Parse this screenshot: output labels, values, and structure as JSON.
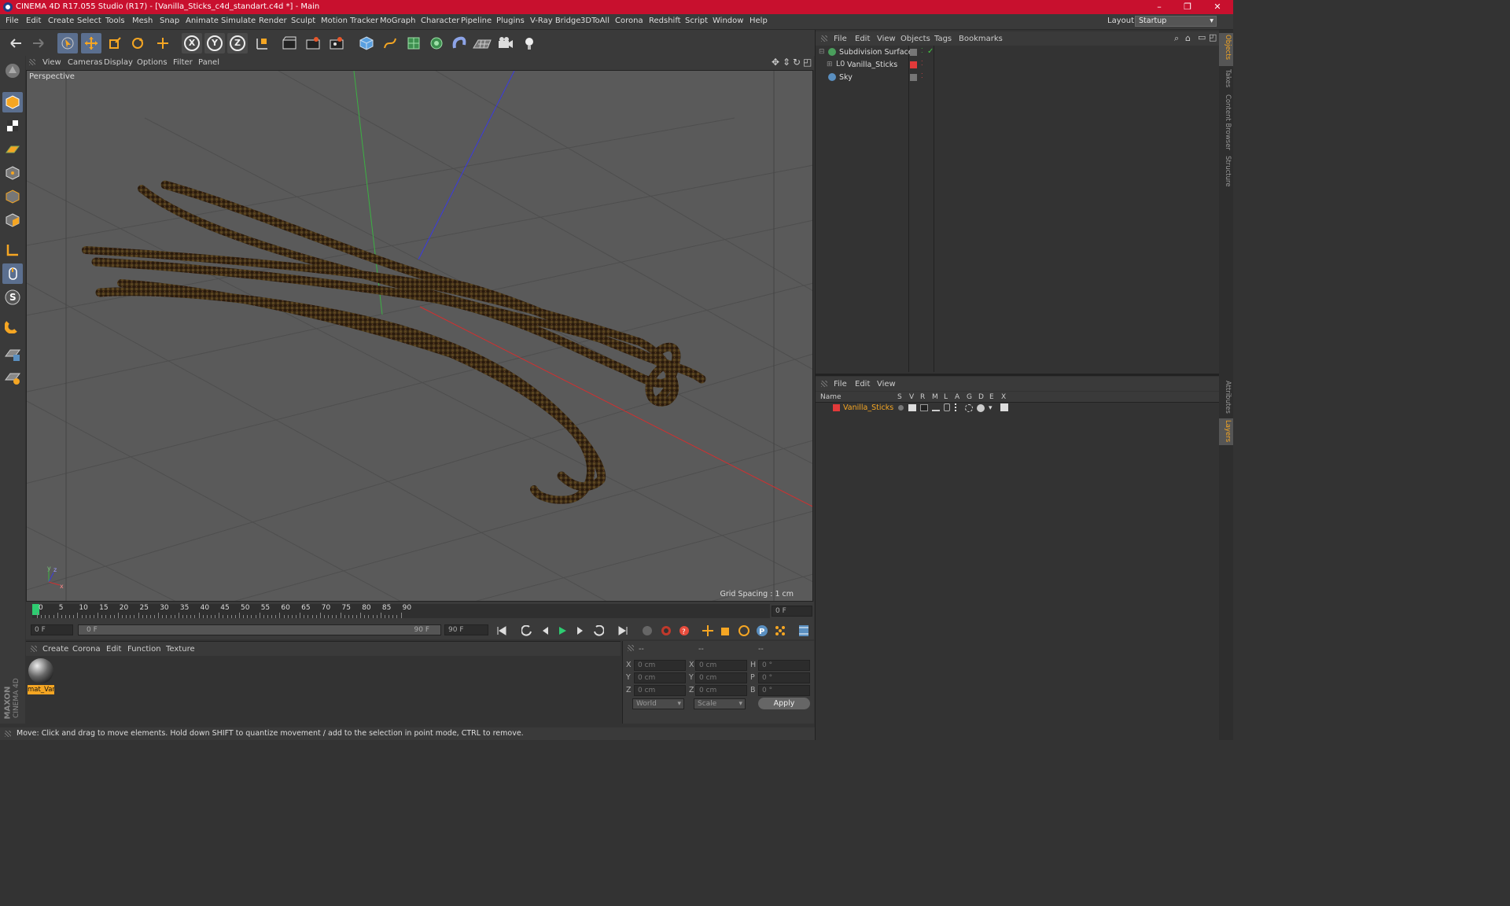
{
  "title_bar": {
    "title": "CINEMA 4D R17.055 Studio (R17) - [Vanilla_Sticks_c4d_standart.c4d *] - Main",
    "minimize": "–",
    "maximize": "❐",
    "close": "✕"
  },
  "menu": [
    "File",
    "Edit",
    "Create",
    "Select",
    "Tools",
    "Mesh",
    "Snap",
    "Animate",
    "Simulate",
    "Render",
    "Sculpt",
    "Motion Tracker",
    "MoGraph",
    "Character",
    "Pipeline",
    "Plugins",
    "V-Ray Bridge",
    "3DToAll",
    "Corona",
    "Redshift",
    "Script",
    "Window",
    "Help"
  ],
  "layout": {
    "label": "Layout:",
    "value": "Startup"
  },
  "toolbar": {
    "icons": [
      "undo-icon",
      "redo-icon",
      "select-icon",
      "move-icon",
      "scale-icon",
      "rotate-icon",
      "transform-icon",
      "x-axis-icon",
      "y-axis-icon",
      "z-axis-icon",
      "world-coords-icon",
      "render-view-icon",
      "render-picture-viewer-icon",
      "render-settings-icon",
      "cube-icon",
      "pen-spline-icon",
      "subdivision-icon",
      "cloner-icon",
      "deformer-icon",
      "floor-icon",
      "camera-icon",
      "light-icon"
    ],
    "axis_labels": [
      "X",
      "Y",
      "Z"
    ]
  },
  "left_tools": [
    "make-editable-icon",
    "model-mode-icon",
    "texture-mode-icon",
    "workplane-icon",
    "points-mode-icon",
    "edges-mode-icon",
    "polygons-mode-icon",
    "axis-icon",
    "tweak-icon",
    "snap-s-icon",
    "magnet-icon",
    "grid-lock-icon",
    "solo-icon"
  ],
  "viewport": {
    "menu": [
      "View",
      "Cameras",
      "Display",
      "Options",
      "Filter",
      "Panel"
    ],
    "label": "Perspective",
    "grid_spacing": "Grid Spacing : 1 cm"
  },
  "timeline": {
    "ticks": [
      "0",
      "5",
      "10",
      "15",
      "20",
      "25",
      "30",
      "35",
      "40",
      "45",
      "50",
      "55",
      "60",
      "65",
      "70",
      "75",
      "80",
      "85",
      "90"
    ],
    "current_frame_field": "0 F",
    "start_field": "0 F",
    "slider_start": "0 F",
    "slider_end": "90 F",
    "end_field": "90 F"
  },
  "materials": {
    "menu": [
      "Create",
      "Corona",
      "Edit",
      "Function",
      "Texture"
    ],
    "items": [
      {
        "name": "mat_Var"
      }
    ]
  },
  "coordinates": {
    "headers": [
      "--",
      "--",
      "--"
    ],
    "rows": [
      {
        "a": "X",
        "av": "0 cm",
        "b": "X",
        "bv": "0 cm",
        "c": "H",
        "cv": "0 °"
      },
      {
        "a": "Y",
        "av": "0 cm",
        "b": "Y",
        "bv": "0 cm",
        "c": "P",
        "cv": "0 °"
      },
      {
        "a": "Z",
        "av": "0 cm",
        "b": "Z",
        "bv": "0 cm",
        "c": "B",
        "cv": "0 °"
      }
    ],
    "world": "World",
    "scale": "Scale",
    "apply": "Apply"
  },
  "status": "Move: Click and drag to move elements. Hold down SHIFT to quantize movement / add to the selection in point mode, CTRL to remove.",
  "objects_panel": {
    "menu": [
      "File",
      "Edit",
      "View",
      "Objects",
      "Tags",
      "Bookmarks"
    ],
    "items": [
      {
        "name": "Subdivision Surface",
        "color": "#4a9e5c"
      },
      {
        "name": "Vanilla_Sticks",
        "color": "#cccccc"
      },
      {
        "name": "Sky",
        "color": "#5a8fc0"
      }
    ]
  },
  "layers_panel": {
    "menu": [
      "File",
      "Edit",
      "View"
    ],
    "columns": [
      "Name",
      "S",
      "V",
      "R",
      "M",
      "L",
      "A",
      "G",
      "D",
      "E",
      "X"
    ],
    "items": [
      {
        "name": "Vanilla_Sticks",
        "color": "#e23a3a"
      }
    ]
  },
  "side_tabs": [
    "Objects",
    "Takes",
    "Content Browser",
    "Structure",
    "Attributes",
    "Layers"
  ],
  "brand": {
    "maxon": "MAXON",
    "product": "CINEMA 4D"
  }
}
